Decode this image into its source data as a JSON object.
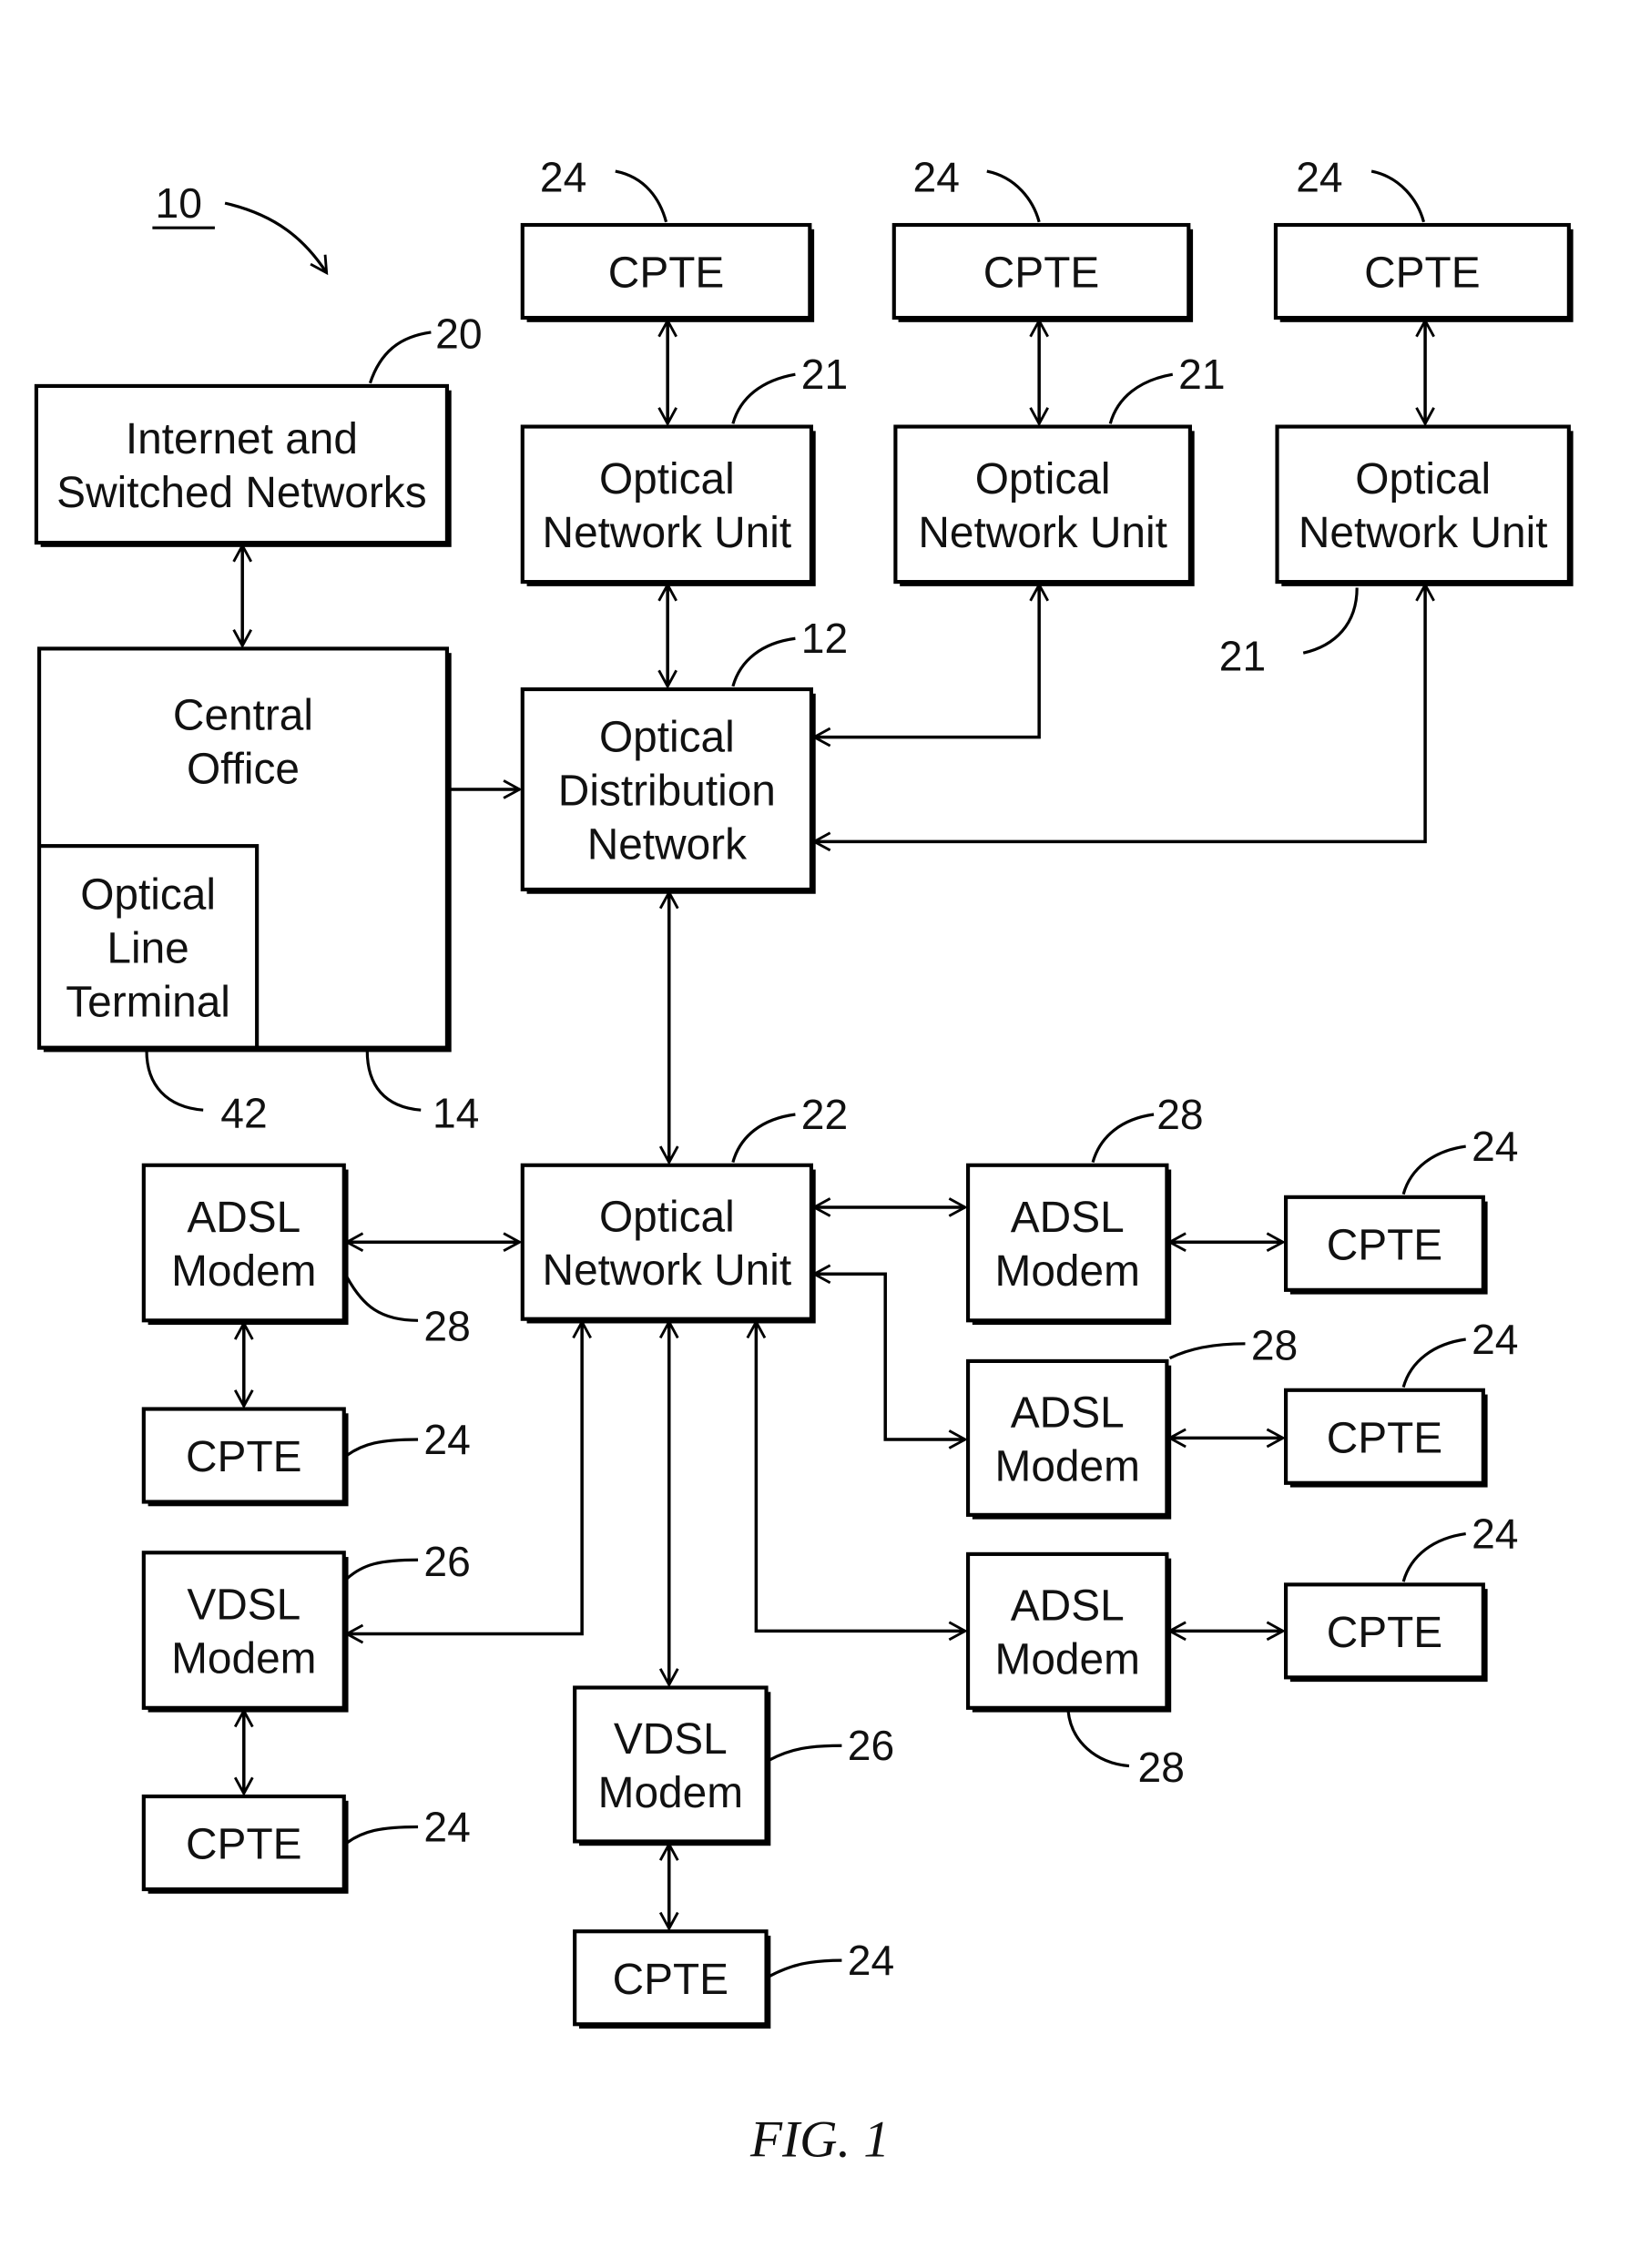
{
  "figure": {
    "title": "FIG. 1",
    "system_ref": "10"
  },
  "boxes": {
    "internet": {
      "lines": [
        "Internet and",
        "Switched Networks"
      ],
      "ref": "20"
    },
    "central_office": {
      "lines": [
        "Central",
        "Office"
      ],
      "ref": "14"
    },
    "olt": {
      "lines": [
        "Optical",
        "Line",
        "Terminal"
      ],
      "ref": "42"
    },
    "odn": {
      "lines": [
        "Optical",
        "Distribution",
        "Network"
      ],
      "ref": "12"
    },
    "onu_top_1": {
      "lines": [
        "Optical",
        "Network Unit"
      ],
      "ref": "21"
    },
    "onu_top_2": {
      "lines": [
        "Optical",
        "Network Unit"
      ],
      "ref": "21"
    },
    "onu_top_3": {
      "lines": [
        "Optical",
        "Network Unit"
      ],
      "ref": "21"
    },
    "cpte_top_1": {
      "lines": [
        "CPTE"
      ],
      "ref": "24"
    },
    "cpte_top_2": {
      "lines": [
        "CPTE"
      ],
      "ref": "24"
    },
    "cpte_top_3": {
      "lines": [
        "CPTE"
      ],
      "ref": "24"
    },
    "onu_main": {
      "lines": [
        "Optical",
        "Network Unit"
      ],
      "ref": "22"
    },
    "adsl_left": {
      "lines": [
        "ADSL",
        "Modem"
      ],
      "ref": "28"
    },
    "cpte_left_1": {
      "lines": [
        "CPTE"
      ],
      "ref": "24"
    },
    "vdsl_left": {
      "lines": [
        "VDSL",
        "Modem"
      ],
      "ref": "26"
    },
    "cpte_left_2": {
      "lines": [
        "CPTE"
      ],
      "ref": "24"
    },
    "vdsl_center": {
      "lines": [
        "VDSL",
        "Modem"
      ],
      "ref": "26"
    },
    "cpte_center": {
      "lines": [
        "CPTE"
      ],
      "ref": "24"
    },
    "adsl_right_1": {
      "lines": [
        "ADSL",
        "Modem"
      ],
      "ref": "28"
    },
    "adsl_right_2": {
      "lines": [
        "ADSL",
        "Modem"
      ],
      "ref": "28"
    },
    "adsl_right_3": {
      "lines": [
        "ADSL",
        "Modem"
      ],
      "ref": "28"
    },
    "cpte_right_1": {
      "lines": [
        "CPTE"
      ],
      "ref": "24"
    },
    "cpte_right_2": {
      "lines": [
        "CPTE"
      ],
      "ref": "24"
    },
    "cpte_right_3": {
      "lines": [
        "CPTE"
      ],
      "ref": "24"
    }
  }
}
